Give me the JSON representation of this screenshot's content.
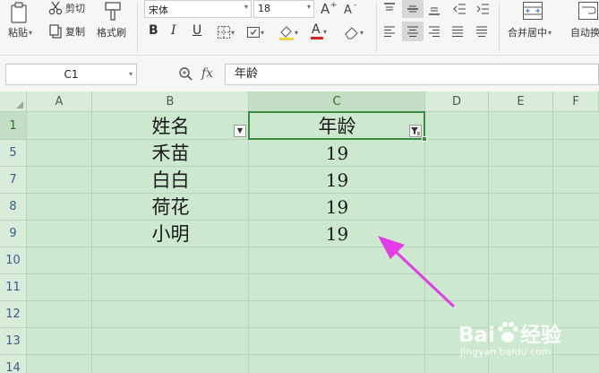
{
  "ribbon": {
    "paste_label": "粘贴",
    "cut_label": "剪切",
    "copy_label": "复制",
    "format_painter_label": "格式刷",
    "font_name": "宋体",
    "font_size": "18",
    "bold": "B",
    "italic": "I",
    "underline": "U",
    "merge_label": "合并居中",
    "autowrap_label": "自动换",
    "font_color_letter": "A",
    "accent_font_color": "#e0201f",
    "accent_fill_color": "#f6d23b"
  },
  "formula_bar": {
    "cell_ref": "C1",
    "fx": "fx",
    "content": "年龄"
  },
  "sheet": {
    "columns": [
      "A",
      "B",
      "C",
      "D",
      "E",
      "F"
    ],
    "rows": [
      "1",
      "5",
      "7",
      "8",
      "9",
      "10",
      "11",
      "12",
      "13",
      "14"
    ],
    "header": {
      "name": "姓名",
      "age": "年龄"
    },
    "records": [
      {
        "name": "禾苗",
        "age": "19"
      },
      {
        "name": "白白",
        "age": "19"
      },
      {
        "name": "荷花",
        "age": "19"
      },
      {
        "name": "小明",
        "age": "19"
      }
    ],
    "active_cell": "C1",
    "grid_color": "#cce8cf",
    "selection_color": "#3d8a45"
  },
  "annotation": {
    "arrow_color": "#e43ce6"
  },
  "watermark": {
    "brand": "Bai",
    "brand_suffix": "经验",
    "url": "jingyan.baidu.com"
  }
}
